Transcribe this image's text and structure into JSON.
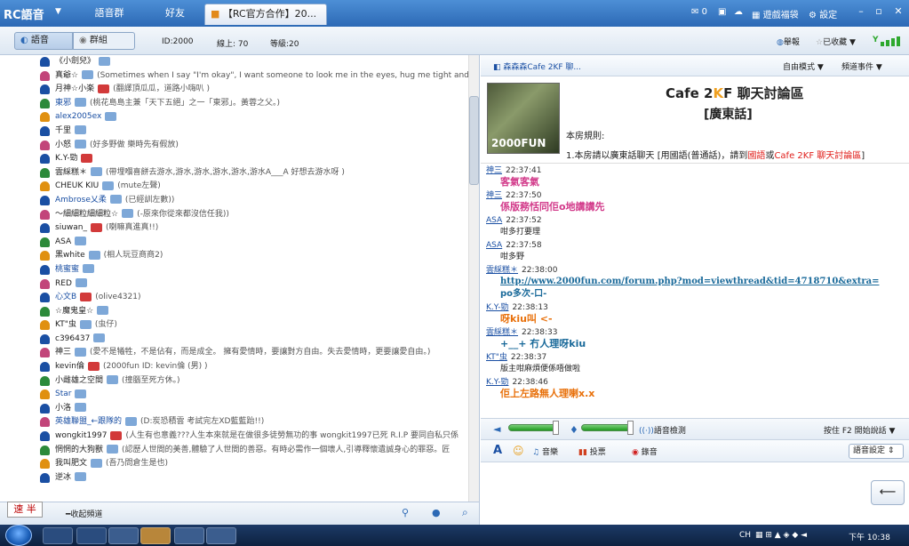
{
  "app": {
    "logo_rc": "RC",
    "logo_cn": "語音",
    "tabs": [
      "語音群",
      "好友",
      "【RC官方合作】20..."
    ],
    "coins": "0",
    "game_gift": "遊戲福袋",
    "settings": "設定"
  },
  "toolbar": {
    "voice": "語音",
    "group": "群組",
    "id_text": "ID:2000",
    "online_text": "線上: 70",
    "level_text": "等級:20",
    "report": "舉報",
    "favorites": "已收藏"
  },
  "users": [
    {
      "name": "《小劍兒》",
      "status": ""
    },
    {
      "name": "真爺☆",
      "status": "(Sometimes when I say \"I'm okay\", I want someone to look me in the eyes, hug me tight and say, \"I know you ar"
    },
    {
      "name": "月神☆小楽",
      "status": "(翻譯頂瓜瓜，道路小嗨叭 )"
    },
    {
      "name": "東邪",
      "status": "(桃花島島主兼「天下五絕」之一「東邪」。黃蓉之父。)"
    },
    {
      "name": "alex2005ex",
      "status": ""
    },
    {
      "name": "千里",
      "status": ""
    },
    {
      "name": "小怒",
      "status": "(好多野做 樂時先有假放)"
    },
    {
      "name": "K.Y-勁",
      "status": ""
    },
    {
      "name": "雲綵糕＊",
      "status": "(帶埋嗰喜餅去游水,游水,游水,游水,游水,游水A___A 好想去游水呀 )"
    },
    {
      "name": "CHEUK KIU",
      "status": "(mute左聲)"
    },
    {
      "name": "Ambrose乂柔",
      "status": "(已經訓左數))"
    },
    {
      "name": "～細細粒細細粒☆",
      "status": "(-原來你從來都沒信任我))"
    },
    {
      "name": "siuwan_",
      "status": "(喇嘛真進真!!)"
    },
    {
      "name": "ASA",
      "status": ""
    },
    {
      "name": "黑white",
      "status": "(相人玩豆商商2)"
    },
    {
      "name": "桃蜜蜜",
      "status": ""
    },
    {
      "name": "RED",
      "status": ""
    },
    {
      "name": "心文B",
      "status": "(olive4321)"
    },
    {
      "name": "☆魔鬼皇☆",
      "status": ""
    },
    {
      "name": "KT\"虫",
      "status": "(虫仔)"
    },
    {
      "name": "c396437",
      "status": ""
    },
    {
      "name": "神三",
      "status": "(愛不是犧牲，不是佔有，而是成全。 擁有愛情時，要讓對方自由。失去愛情時，更要讓愛自由。)"
    },
    {
      "name": "kevin倫",
      "status": "(2000fun ID: kevin倫 (男) )"
    },
    {
      "name": "小雌雄之空間",
      "status": "(撞腦至死方休。)"
    },
    {
      "name": "Star",
      "status": ""
    },
    {
      "name": "小洛",
      "status": ""
    },
    {
      "name": "英雄聯盟_←跟隊的",
      "status": "(D:炭恐積雲 考試完左XD藍藍跆!!)"
    },
    {
      "name": "wongkit1997",
      "status": "(人生有也意義???人生本來就是在做很多徒勞無功的事 wongkit1997已死 R.I.P 要同自私只係"
    },
    {
      "name": "惘惘的大狗獸",
      "status": "(認歷人世間的美善,體驗了人世間的善惡。有時必需作一個壞人,引導釋懷遺誠身心的罪惡。匠"
    },
    {
      "name": "我叫肥文",
      "status": "(吾乃問倉生是也)"
    },
    {
      "name": "逆冰",
      "status": ""
    }
  ],
  "left_bottom": {
    "ime_a": "速",
    "ime_b": "半",
    "collapse": "收起頻道"
  },
  "right": {
    "channel_path": "森森森Cafe 2KF 聊...",
    "mode": "自由模式",
    "events": "頻道事件",
    "banner_title_a": "Cafe 2",
    "banner_title_k": "K",
    "banner_title_b": "F 聊天討論區",
    "banner_subtitle": "[廣東話]",
    "banner_img": "2000FUN",
    "rules_label": "本房規則:",
    "rule1": "1.本房請以廣東話聊天 [用國語(普通話)，請到",
    "rule1_a": "國語",
    "rule1_b": "或",
    "rule1_c": "Cafe 2KF 聊天討論區",
    "rule1_end": "]"
  },
  "chat": [
    {
      "user": "神三",
      "time": "22:37:41",
      "text": "客氣客氣",
      "color": "#d23a8a"
    },
    {
      "user": "神三",
      "time": "22:37:50",
      "text": "係版務恬同佢o地講講先",
      "color": "#d23a8a"
    },
    {
      "user": "ASA",
      "time": "22:37:52",
      "text": "咁多打要理",
      "color": "#222222"
    },
    {
      "user": "ASA",
      "time": "22:37:58",
      "text": "咁多野",
      "color": "#222222"
    },
    {
      "user": "雲綵糕＊",
      "time": "22:38:00",
      "text": "http://www.2000fun.com/forum.php?mod=viewthread&tid=4718710&extra=",
      "color": "#1a6a9a",
      "text2": "po多次-口-"
    },
    {
      "user": "K.Y-勁",
      "time": "22:38:13",
      "text": "呀kiu叫 <-",
      "color": "#e8700a"
    },
    {
      "user": "雲綵糕＊",
      "time": "22:38:33",
      "text": "+__+ 冇人理呀kiu",
      "color": "#1a6a9a"
    },
    {
      "user": "KT\"虫",
      "time": "22:38:37",
      "text": "版主咁麻煩便係唔做啦",
      "color": "#222222"
    },
    {
      "user": "K.Y-勁",
      "time": "22:38:46",
      "text": "佢上左路無人理喇x.x",
      "color": "#e8700a"
    }
  ],
  "voice": {
    "detect": "語音檢測",
    "press": "按住 F2 開始說話"
  },
  "actions": {
    "music": "音樂",
    "vote": "投票",
    "record": "錄音",
    "settings": "語音設定"
  },
  "taskbar": {
    "lang": "CH",
    "clock": "下午 10:38"
  },
  "colors": {
    "brand": "#2c69b5",
    "red_link": "#e0201c",
    "signal": "#2ea82e"
  }
}
